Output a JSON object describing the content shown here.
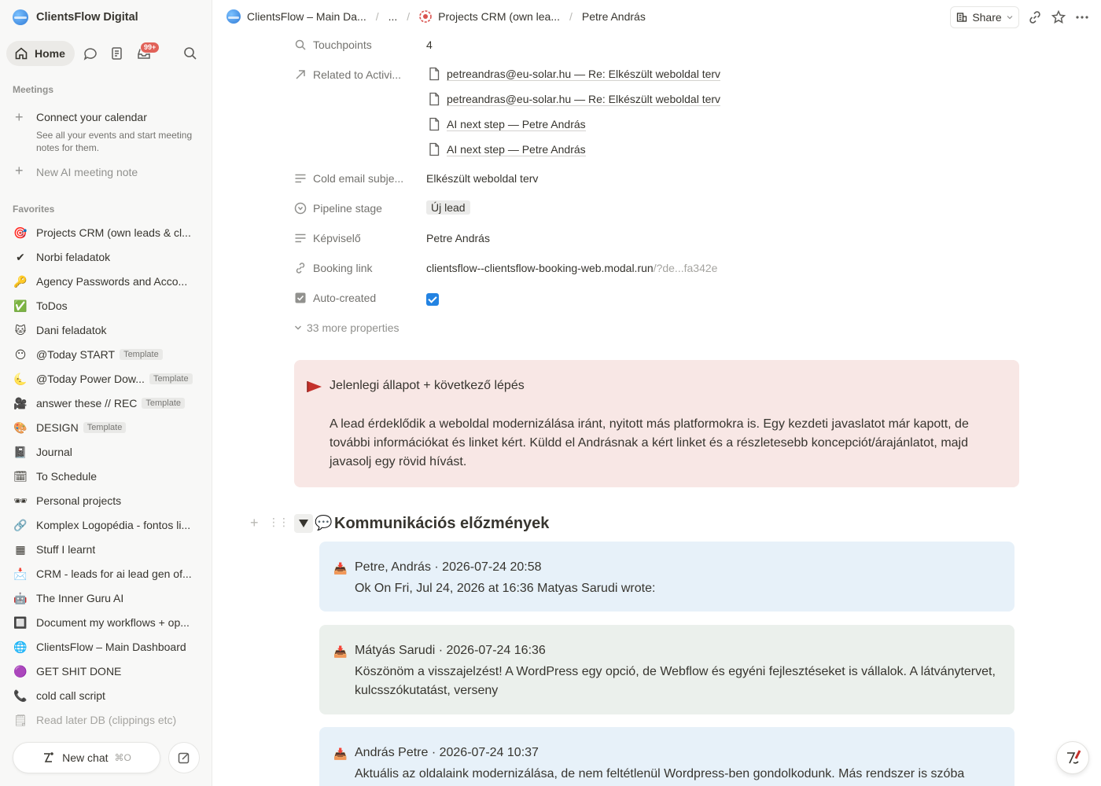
{
  "workspace": {
    "name": "ClientsFlow Digital"
  },
  "topnav": {
    "home": "Home",
    "badge": "99+"
  },
  "meetings": {
    "label": "Meetings",
    "connect_title": "Connect your calendar",
    "connect_sub": "See all your events and start meeting notes for them.",
    "new_note": "New AI meeting note"
  },
  "favorites": {
    "label": "Favorites",
    "items": [
      {
        "icon": "🎯",
        "label": "Projects CRM (own leads & cl..."
      },
      {
        "icon": "✔",
        "label": "Norbi feladatok"
      },
      {
        "icon": "🔑",
        "label": "Agency Passwords and Acco..."
      },
      {
        "icon": "✅",
        "label": "ToDos"
      },
      {
        "icon": "🐱",
        "label": "Dani feladatok"
      },
      {
        "icon": "😶",
        "label": "@Today START",
        "tag": "Template"
      },
      {
        "icon": "🌜",
        "label": "@Today Power Dow...",
        "tag": "Template"
      },
      {
        "icon": "🎥",
        "label": "answer these // REC",
        "tag": "Template"
      },
      {
        "icon": "🎨",
        "label": "DESIGN",
        "tag": "Template"
      },
      {
        "icon": "📓",
        "label": "Journal"
      },
      {
        "icon": "🗓",
        "label": "To Schedule"
      },
      {
        "icon": "🕶",
        "label": "Personal projects"
      },
      {
        "icon": "🔗",
        "label": "Komplex Logopédia - fontos li..."
      },
      {
        "icon": "▦",
        "label": "Stuff I learnt"
      },
      {
        "icon": "📩",
        "label": "CRM - leads for ai lead gen of..."
      },
      {
        "icon": "🤖",
        "label": "The Inner Guru AI"
      },
      {
        "icon": "🔲",
        "label": "Document my workflows + op..."
      },
      {
        "icon": "🌐",
        "label": "ClientsFlow – Main Dashboard"
      },
      {
        "icon": "🟣",
        "label": "GET SHIT DONE"
      },
      {
        "icon": "📞",
        "label": "cold call script"
      },
      {
        "icon": "🗒",
        "label": "Read later DB (clippings etc)"
      }
    ]
  },
  "bottom": {
    "new_chat": "New chat",
    "shortcut": "⌘O"
  },
  "breadcrumb": {
    "c1": "ClientsFlow – Main Da...",
    "c2": "...",
    "c3": "Projects CRM (own lea...",
    "c4": "Petre András"
  },
  "header": {
    "share": "Share"
  },
  "props": {
    "touchpoints_label": "Touchpoints",
    "touchpoints_value": "4",
    "related_label": "Related to Activi...",
    "related": [
      "petreandras@eu-solar.hu — Re: Elkészült weboldal terv",
      "petreandras@eu-solar.hu — Re: Elkészült weboldal terv",
      "AI next step — Petre András",
      "AI next step — Petre András"
    ],
    "cold_label": "Cold email subje...",
    "cold_value": "Elkészült weboldal terv",
    "pipeline_label": "Pipeline stage",
    "pipeline_value": "Új lead",
    "kepviselo_label": "Képviselő",
    "kepviselo_value": "Petre András",
    "booking_label": "Booking link",
    "booking_value": "clientsflow--clientsflow-booking-web.modal.run",
    "booking_suffix": "/?de...fa342e",
    "auto_label": "Auto-created",
    "auto_checked": true,
    "more": "33 more properties"
  },
  "callout": {
    "title": "Jelenlegi állapot + következő lépés",
    "body": "A lead érdeklődik a weboldal modernizálása iránt, nyitott más platformokra is. Egy kezdeti javaslatot már kapott, de további információkat és linket kért. Küldd el Andrásnak a kért linket és a részletesebb koncepciót/árajánlatot, majd javasolj egy rövid hívást."
  },
  "heading": {
    "emoji": "💬",
    "title": "Kommunikációs előzmények"
  },
  "messages": [
    {
      "header": "Petre, András · 2026-07-24 20:58",
      "body": "Ok On Fri, Jul 24, 2026 at 16:36 Matyas Sarudi wrote:"
    },
    {
      "header": "Mátyás Sarudi · 2026-07-24 16:36",
      "body": "Köszönöm a visszajelzést! A WordPress egy opció, de Webflow és egyéni fejlesztéseket is vállalok. A látványtervet, kulcsszókutatást, verseny"
    },
    {
      "header": "András Petre · 2026-07-24 10:37",
      "body": "Aktuális az oldalaink modernizálása, de nem feltétlenül Wordpress-ben gondolkodunk. Más rendszer is szóba"
    }
  ]
}
